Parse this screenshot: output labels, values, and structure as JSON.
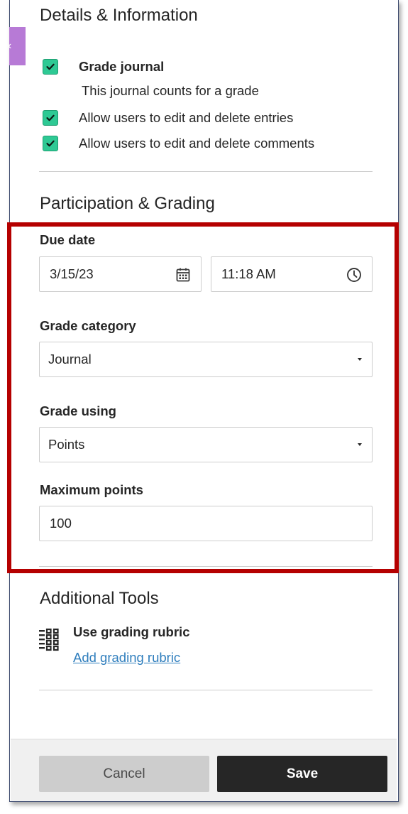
{
  "collapse_tab": {
    "icon": "chevron-left-icon",
    "glyph": "‹"
  },
  "details": {
    "heading": "Details & Information",
    "grade_journal": {
      "label": "Grade journal",
      "checked": true,
      "description": "This journal counts for a grade"
    },
    "allow_edit_entries": {
      "label": "Allow users to edit and delete entries",
      "checked": true
    },
    "allow_edit_comments": {
      "label": "Allow users to edit and delete comments",
      "checked": true
    }
  },
  "participation": {
    "heading": "Participation & Grading",
    "due_date": {
      "label": "Due date",
      "date": "3/15/23",
      "time": "11:18 AM",
      "date_icon": "calendar-icon",
      "time_icon": "clock-icon"
    },
    "grade_category": {
      "label": "Grade category",
      "value": "Journal"
    },
    "grade_using": {
      "label": "Grade using",
      "value": "Points"
    },
    "maximum_points": {
      "label": "Maximum points",
      "value": "100"
    }
  },
  "additional_tools": {
    "heading": "Additional Tools",
    "rubric": {
      "icon": "rubric-grid-icon",
      "title": "Use grading rubric",
      "link": "Add grading rubric"
    }
  },
  "footer": {
    "cancel_label": "Cancel",
    "save_label": "Save"
  },
  "colors": {
    "checkbox": "#2ec994",
    "highlight": "#b50000",
    "link": "#2f7ebd",
    "save_button": "#262626",
    "tab": "#b77ad6"
  }
}
